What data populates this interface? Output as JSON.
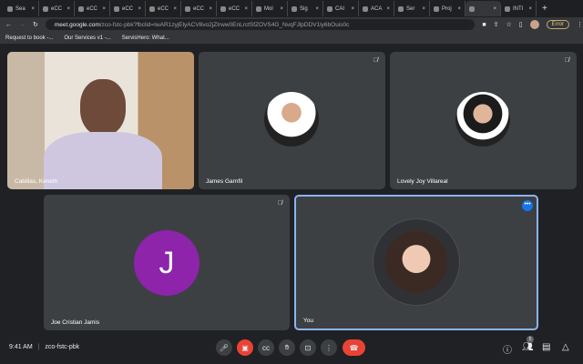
{
  "browser": {
    "tabs": [
      {
        "label": "Sea",
        "icon": "gmail-icon"
      },
      {
        "label": "eCC",
        "icon": "globe-icon"
      },
      {
        "label": "eCC",
        "icon": "globe-icon"
      },
      {
        "label": "eCC",
        "icon": "globe-icon"
      },
      {
        "label": "eCC",
        "icon": "globe-icon"
      },
      {
        "label": "eCC",
        "icon": "globe-icon"
      },
      {
        "label": "eCC",
        "icon": "globe-icon"
      },
      {
        "label": "Mol",
        "icon": "doc-icon"
      },
      {
        "label": "Sig",
        "icon": "doc-icon"
      },
      {
        "label": "CAI",
        "icon": "doc-icon"
      },
      {
        "label": "ACA",
        "icon": "doc-icon"
      },
      {
        "label": "Ser",
        "icon": "circle-icon"
      },
      {
        "label": "Proj",
        "icon": "circle-icon"
      },
      {
        "label": "",
        "icon": "meet-icon",
        "active": true
      },
      {
        "label": "INTI",
        "icon": "sheet-icon"
      }
    ],
    "url_domain": "meet.google.com",
    "url_path": "/zco-fstc-pbk?fbclid=IwAR1zyjElyACV8vo2jZIrww0EnLrctSfZOVS4G_NvqFJlpDDV1ly6bOuis0c",
    "error_label": "Error",
    "bookmarks": [
      "Request to book -...",
      "Our Services v1 -...",
      "ServisHero: What..."
    ]
  },
  "participants": [
    {
      "name": "Cabillas, Keneth",
      "video": true
    },
    {
      "name": "James Garnfil",
      "muted": true
    },
    {
      "name": "Lovely Joy Villareal",
      "muted": true
    },
    {
      "name": "Joe Cristian Jamis",
      "initial": "J",
      "avatar_color": "#8e24aa",
      "muted": true
    },
    {
      "name": "You",
      "active_speaker": true
    }
  ],
  "footer": {
    "time": "9:41 AM",
    "meeting_code": "zco-fstc-pbk",
    "participant_count": "5"
  },
  "colors": {
    "accent": "#8ab4f8",
    "end_call": "#ea4335"
  }
}
